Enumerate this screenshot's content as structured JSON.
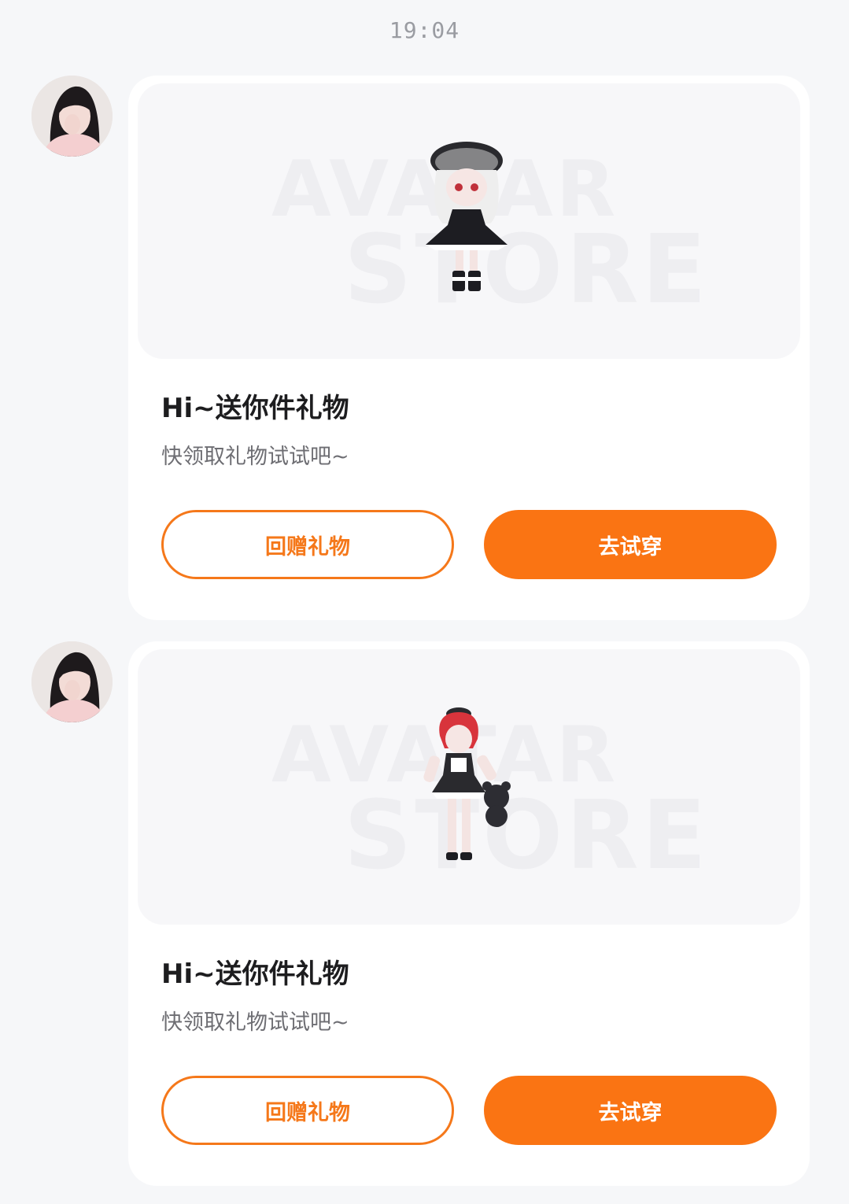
{
  "timestamp": "19:04",
  "colors": {
    "accent": "#fa7413",
    "background": "#f6f7f9",
    "card": "#ffffff"
  },
  "messages": [
    {
      "sender_avatar": "user-avatar",
      "watermark": {
        "line1": "AVATAR",
        "line2": "STORE"
      },
      "item_image": "gothic-lolita-avatar-figure",
      "title": "Hi~送你件礼物",
      "subtitle": "快领取礼物试试吧~",
      "return_gift_label": "回赠礼物",
      "try_on_label": "去试穿"
    },
    {
      "sender_avatar": "user-avatar",
      "watermark": {
        "line1": "AVATAR",
        "line2": "STORE"
      },
      "item_image": "red-hair-maid-avatar-figure",
      "title": "Hi~送你件礼物",
      "subtitle": "快领取礼物试试吧~",
      "return_gift_label": "回赠礼物",
      "try_on_label": "去试穿"
    }
  ]
}
